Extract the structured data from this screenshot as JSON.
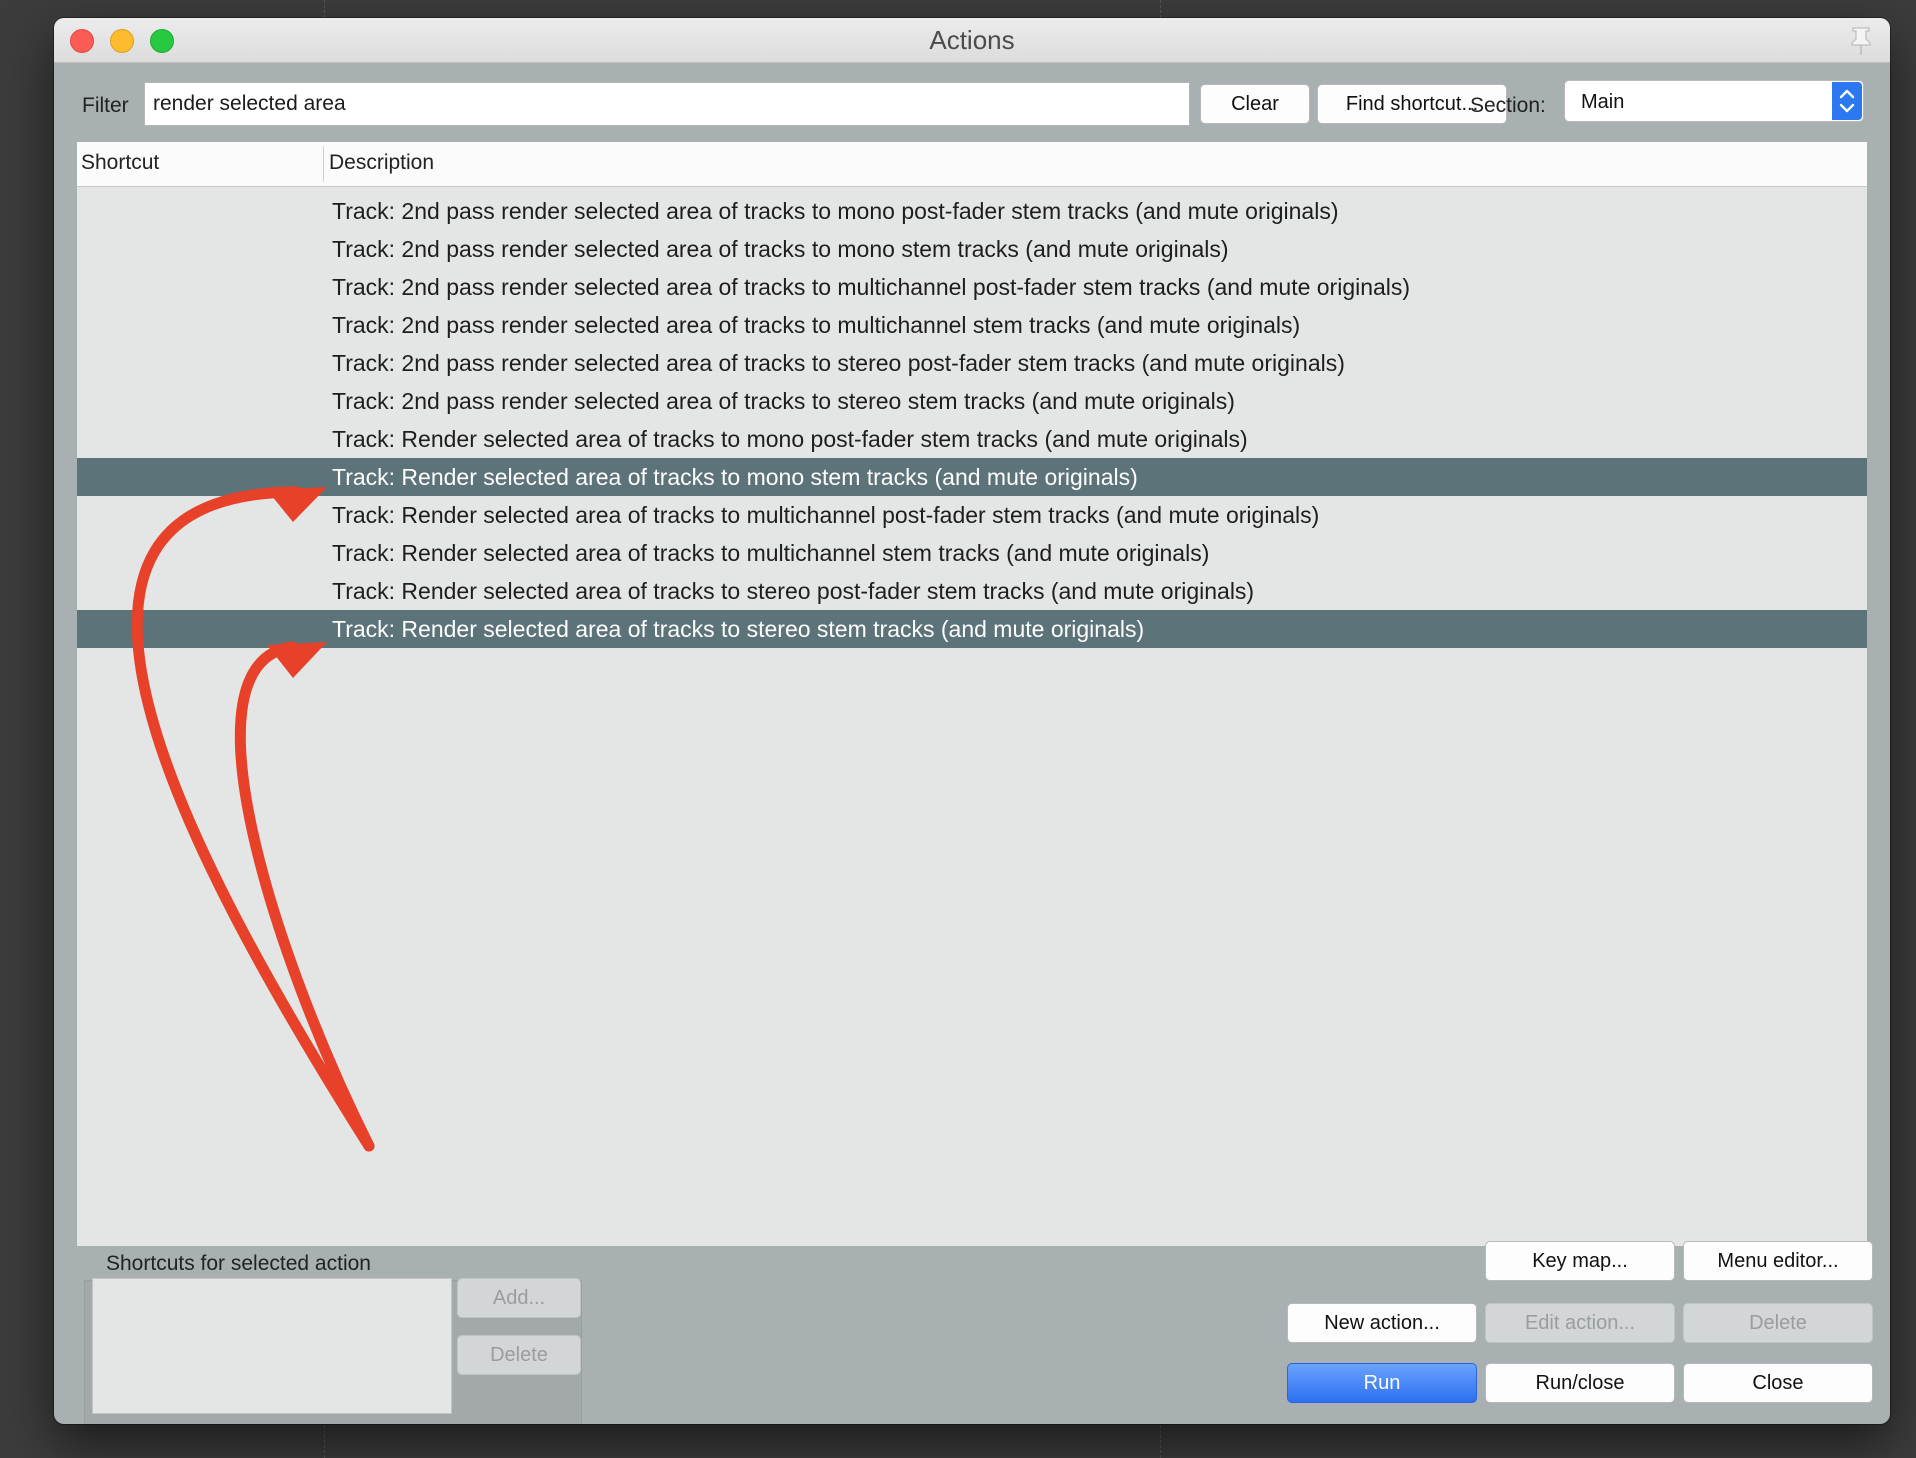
{
  "window": {
    "title": "Actions"
  },
  "filter": {
    "label": "Filter",
    "value": "render selected area"
  },
  "toolbar": {
    "clear_label": "Clear",
    "find_shortcut_label": "Find shortcut..."
  },
  "section": {
    "label": "Section:",
    "value": "Main"
  },
  "table": {
    "columns": [
      "Shortcut",
      "Description"
    ],
    "rows": [
      {
        "shortcut": "",
        "description": "Track: 2nd pass render selected area of tracks to mono post-fader stem tracks (and mute originals)",
        "selected": false
      },
      {
        "shortcut": "",
        "description": "Track: 2nd pass render selected area of tracks to mono stem tracks (and mute originals)",
        "selected": false
      },
      {
        "shortcut": "",
        "description": "Track: 2nd pass render selected area of tracks to multichannel post-fader stem tracks (and mute originals)",
        "selected": false
      },
      {
        "shortcut": "",
        "description": "Track: 2nd pass render selected area of tracks to multichannel stem tracks (and mute originals)",
        "selected": false
      },
      {
        "shortcut": "",
        "description": "Track: 2nd pass render selected area of tracks to stereo post-fader stem tracks (and mute originals)",
        "selected": false
      },
      {
        "shortcut": "",
        "description": "Track: 2nd pass render selected area of tracks to stereo stem tracks (and mute originals)",
        "selected": false
      },
      {
        "shortcut": "",
        "description": "Track: Render selected area of tracks to mono post-fader stem tracks (and mute originals)",
        "selected": false
      },
      {
        "shortcut": "",
        "description": "Track: Render selected area of tracks to mono stem tracks (and mute originals)",
        "selected": true
      },
      {
        "shortcut": "",
        "description": "Track: Render selected area of tracks to multichannel post-fader stem tracks (and mute originals)",
        "selected": false
      },
      {
        "shortcut": "",
        "description": "Track: Render selected area of tracks to multichannel stem tracks (and mute originals)",
        "selected": false
      },
      {
        "shortcut": "",
        "description": "Track: Render selected area of tracks to stereo post-fader stem tracks (and mute originals)",
        "selected": false
      },
      {
        "shortcut": "",
        "description": "Track: Render selected area of tracks to stereo stem tracks (and mute originals)",
        "selected": true
      }
    ]
  },
  "shortcuts_panel": {
    "label": "Shortcuts for selected action",
    "add_label": "Add...",
    "delete_label": "Delete"
  },
  "buttons": {
    "key_map": "Key map...",
    "menu_editor": "Menu editor...",
    "new_action": "New action...",
    "edit_action": "Edit action...",
    "delete": "Delete",
    "run": "Run",
    "run_close": "Run/close",
    "close": "Close"
  },
  "colors": {
    "selected_row": "#5c737a",
    "annotation_arrow": "#e8412a",
    "primary_button": "#2d6ff0"
  },
  "icons": [
    "close-light",
    "minimize-light",
    "zoom-light",
    "pin-icon",
    "chevron-updown-icon"
  ]
}
